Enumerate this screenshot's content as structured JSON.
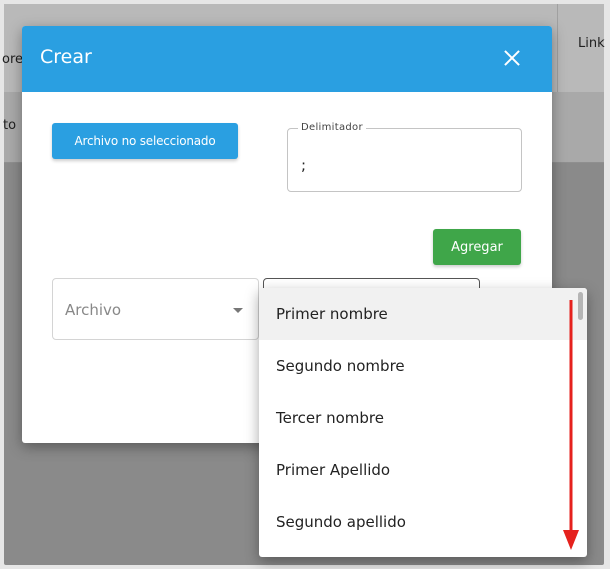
{
  "background": {
    "header_left_fragment": "ore",
    "header_right_label": "Link",
    "row_left_fragment": "to"
  },
  "modal": {
    "title": "Crear",
    "file_button_label": "Archivo no seleccionado",
    "delimiter": {
      "label": "Delimitador",
      "value": ";"
    },
    "add_button_label": "Agregar",
    "archivo_select": {
      "placeholder": "Archivo"
    }
  },
  "dropdown": {
    "items": [
      {
        "label": "Primer nombre",
        "selected": true
      },
      {
        "label": "Segundo nombre",
        "selected": false
      },
      {
        "label": "Tercer nombre",
        "selected": false
      },
      {
        "label": "Primer Apellido",
        "selected": false
      },
      {
        "label": "Segundo apellido",
        "selected": false
      }
    ]
  },
  "colors": {
    "primary": "#2a9fe1",
    "success": "#3fa649",
    "annotation_arrow": "#e5211d"
  },
  "icons": {
    "close": "close-icon",
    "caret": "caret-down-icon",
    "arrow": "arrow-down-annotation"
  }
}
